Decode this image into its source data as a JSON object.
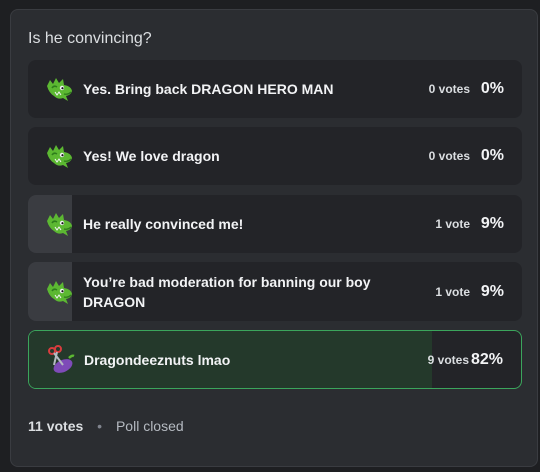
{
  "poll": {
    "question": "Is he convincing?",
    "answers": [
      {
        "label": "Yes. Bring back DRAGON HERO MAN",
        "votes": "0 votes",
        "percent": "0%",
        "fraction": 0.0,
        "icon": "dragon-emoji-icon"
      },
      {
        "label": "Yes! We love dragon",
        "votes": "0 votes",
        "percent": "0%",
        "fraction": 0.0,
        "icon": "dragon-emoji-icon"
      },
      {
        "label": "He really convinced me!",
        "votes": "1 vote",
        "percent": "9%",
        "fraction": 0.09,
        "icon": "dragon-emoji-icon"
      },
      {
        "label": "You’re bad moderation for banning our boy DRAGON",
        "votes": "1 vote",
        "percent": "9%",
        "fraction": 0.09,
        "icon": "dragon-emoji-icon"
      },
      {
        "label": "Dragondeeznuts lmao",
        "votes": "9 votes",
        "percent": "82%",
        "fraction": 0.82,
        "icon": "scissors-eggplant-emoji-icon",
        "winner": true
      }
    ],
    "total_votes": "11 votes",
    "separator": "•",
    "status": "Poll closed"
  },
  "colors": {
    "card_bg": "#2b2d31",
    "answer_bg": "#232428",
    "fill": "#3a3c41",
    "winner_border": "#3ba55c",
    "winner_fill": "#24392b"
  }
}
